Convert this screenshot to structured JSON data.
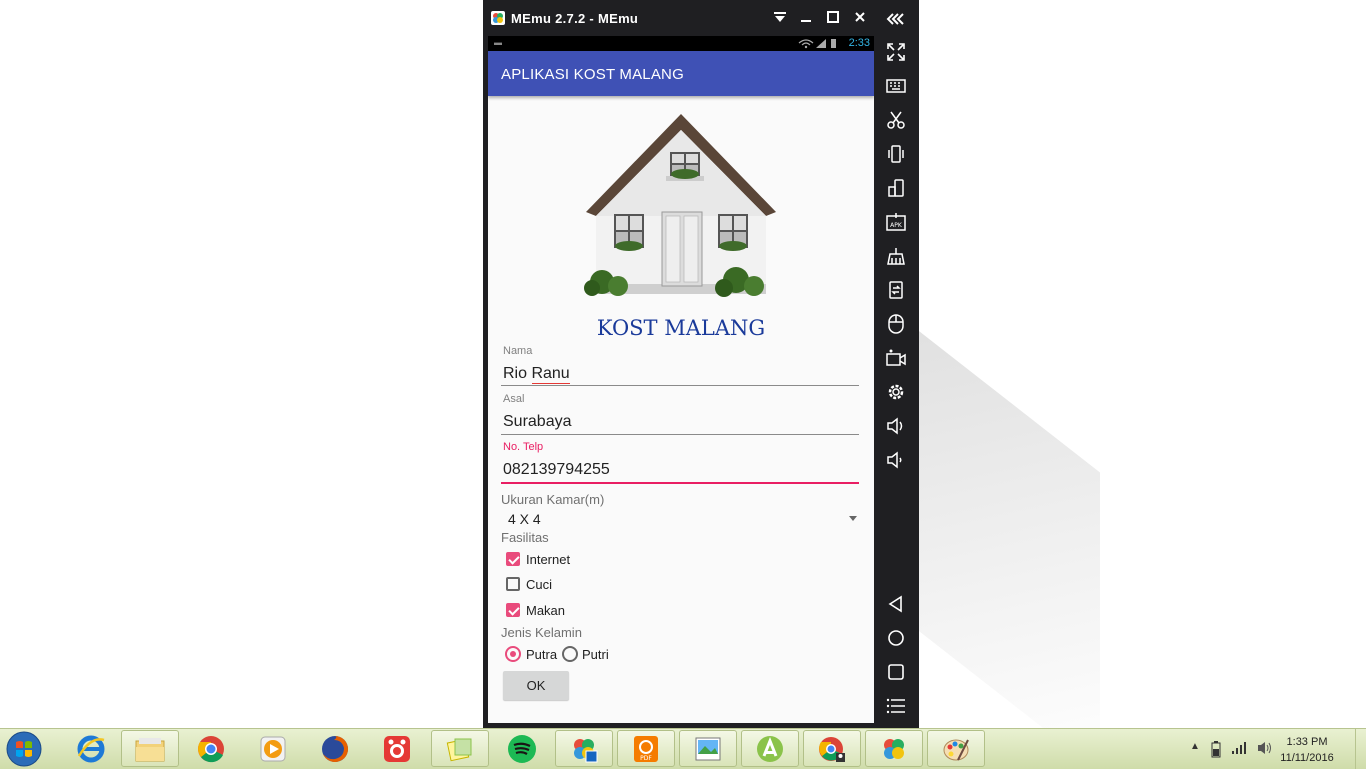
{
  "emulator": {
    "title": "MEmu 2.7.2 - MEmu",
    "side_buttons": [
      "fullscreen-icon",
      "keyboard-icon",
      "scissors-icon",
      "shake-icon",
      "rotate-icon",
      "apk-install-icon",
      "broom-icon",
      "transfer-icon",
      "mouse-icon",
      "record-video-icon",
      "settings-icon",
      "volume-up-icon",
      "volume-down-icon"
    ],
    "nav_buttons": [
      "back-icon",
      "home-icon",
      "recents-icon",
      "menu-icon"
    ]
  },
  "status_bar": {
    "time": "2:33"
  },
  "app": {
    "title": "APLIKASI KOST MALANG",
    "heading": "KOST MALANG",
    "form": {
      "nama_label": "Nama",
      "nama_value": "Rio Ranu",
      "asal_label": "Asal",
      "asal_value": "Surabaya",
      "telp_label": "No. Telp",
      "telp_value": "082139794255",
      "ukuran_label": "Ukuran Kamar(m)",
      "ukuran_value": "4 X 4",
      "fasilitas_label": "Fasilitas",
      "fasilitas": [
        {
          "label": "Internet",
          "checked": true
        },
        {
          "label": "Cuci",
          "checked": false
        },
        {
          "label": "Makan",
          "checked": true
        }
      ],
      "jenis_label": "Jenis Kelamin",
      "jenis_options": [
        {
          "label": "Putra",
          "checked": true
        },
        {
          "label": "Putri",
          "checked": false
        }
      ],
      "ok_label": "OK"
    }
  },
  "taskbar": {
    "items": [
      "internet-explorer-icon",
      "file-explorer-icon",
      "chrome-icon",
      "media-player-icon",
      "firefox-icon",
      "recorder-icon",
      "sticky-notes-icon",
      "spotify-icon",
      "memu-multi-icon",
      "pdf-reader-icon",
      "image-viewer-icon",
      "android-studio-icon",
      "chrome-user-icon",
      "memu-icon",
      "paint-icon"
    ],
    "clock_time": "1:33 PM",
    "clock_date": "11/11/2016"
  },
  "colors": {
    "app_bar": "#3f51b5",
    "accent": "#e91e63",
    "heading": "#1a3a9a"
  }
}
